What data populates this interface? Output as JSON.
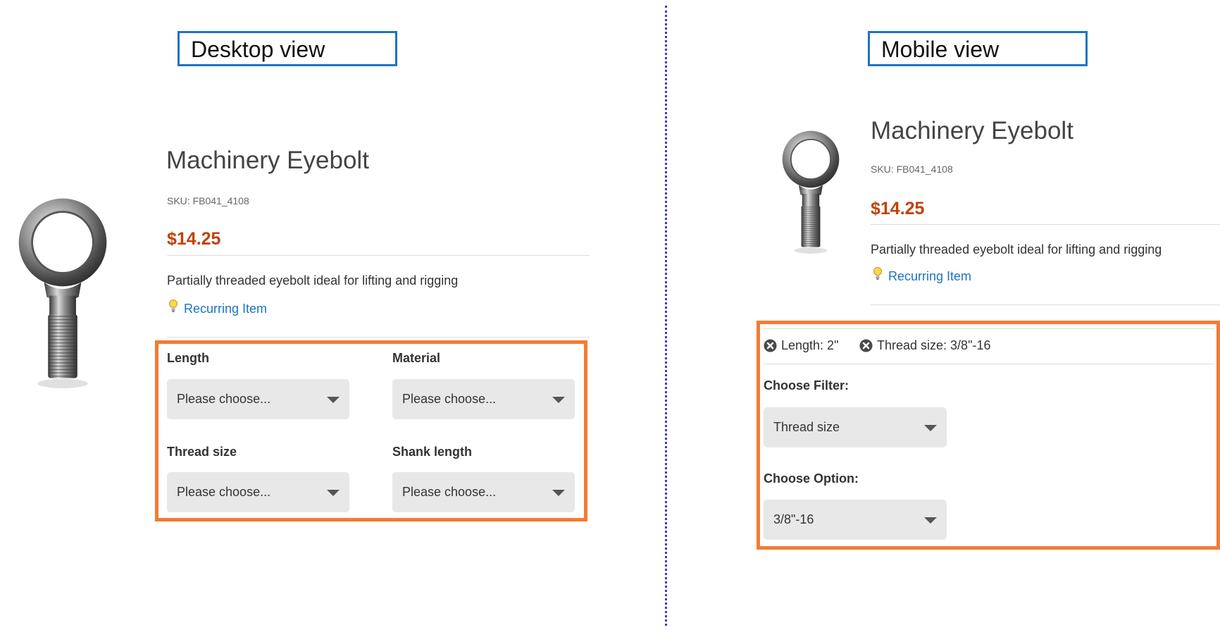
{
  "labels": {
    "desktop": "Desktop view",
    "mobile": "Mobile view"
  },
  "product": {
    "title": "Machinery Eyebolt",
    "sku": "SKU: FB041_4108",
    "price": "$14.25",
    "description": "Partially threaded eyebolt ideal for lifting and rigging",
    "recurring": "Recurring Item"
  },
  "desktop_filters": [
    {
      "label": "Length",
      "value": "Please choose..."
    },
    {
      "label": "Material",
      "value": "Please choose..."
    },
    {
      "label": "Thread size",
      "value": "Please choose..."
    },
    {
      "label": "Shank length",
      "value": "Please choose..."
    }
  ],
  "mobile": {
    "chips": [
      "Length: 2\"",
      "Thread size: 3/8\"-16"
    ],
    "choose_filter_label": "Choose Filter:",
    "choose_filter_value": "Thread size",
    "choose_option_label": "Choose Option:",
    "choose_option_value": "3/8\"-16"
  },
  "colors": {
    "accent_box": "#f57b32",
    "label_border": "#1f73c4",
    "price": "#c0420b",
    "link": "#1a73c9"
  }
}
